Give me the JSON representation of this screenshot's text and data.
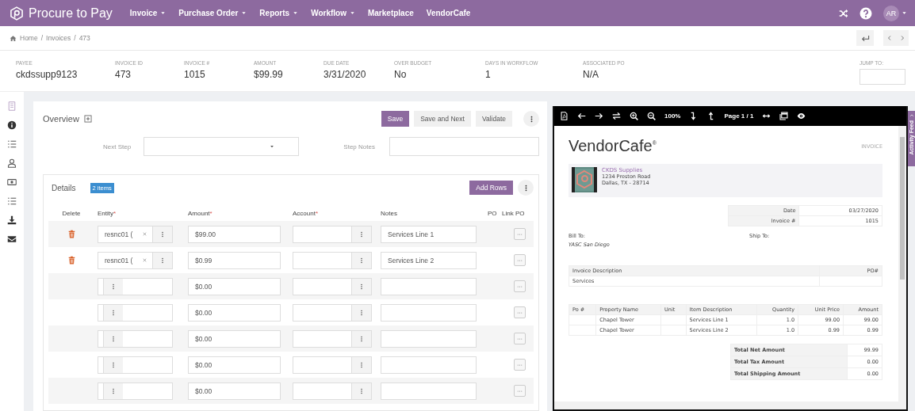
{
  "nav": {
    "brand": "Procure to Pay",
    "menus": [
      {
        "label": "Invoice",
        "dropdown": true
      },
      {
        "label": "Purchase Order",
        "dropdown": true
      },
      {
        "label": "Reports",
        "dropdown": true
      },
      {
        "label": "Workflow",
        "dropdown": true
      },
      {
        "label": "Marketplace",
        "dropdown": false
      },
      {
        "label": "VendorCafe",
        "dropdown": false
      }
    ],
    "avatar": "AR"
  },
  "breadcrumb": {
    "separator": "/",
    "items": [
      "Home",
      "Invoices",
      "473"
    ]
  },
  "summary": {
    "fields": [
      {
        "label": "PAYEE",
        "value": "ckdssupp9123"
      },
      {
        "label": "INVOICE ID",
        "value": "473"
      },
      {
        "label": "INVOICE #",
        "value": "1015"
      },
      {
        "label": "AMOUNT",
        "value": "$99.99"
      },
      {
        "label": "DUE DATE",
        "value": "3/31/2020"
      },
      {
        "label": "OVER BUDGET",
        "value": "No"
      },
      {
        "label": "DAYS IN WORKFLOW",
        "value": "1"
      },
      {
        "label": "ASSOCIATED PO",
        "value": "N/A"
      }
    ],
    "jump_to": {
      "label": "JUMP TO:"
    }
  },
  "overview": {
    "title": "Overview",
    "buttons": [
      {
        "label": "Save",
        "kind": "primary"
      },
      {
        "label": "Save and Next",
        "kind": "default"
      },
      {
        "label": "Validate",
        "kind": "default"
      }
    ],
    "next_step": {
      "label": "Next Step"
    },
    "step_notes": {
      "label": "Step Notes"
    }
  },
  "details": {
    "title": "Details",
    "badge": "2 items",
    "add_rows": "Add Rows",
    "required_mark": "*",
    "columns": [
      {
        "label": "Delete",
        "required": false
      },
      {
        "label": "Entity",
        "required": true
      },
      {
        "label": "Amount",
        "required": true
      },
      {
        "label": "Account",
        "required": true
      },
      {
        "label": "Notes",
        "required": false
      },
      {
        "label": "PO",
        "required": false
      },
      {
        "label": "Link PO",
        "required": false
      }
    ],
    "rows": [
      {
        "deletable": true,
        "entity": "resnc01 (",
        "amount": "$99.00",
        "notes": "Services Line 1"
      },
      {
        "deletable": true,
        "entity": "resnc01 (",
        "amount": "$0.99",
        "notes": "Services Line 2"
      },
      {
        "deletable": false,
        "amount": "$0.00"
      },
      {
        "deletable": false,
        "amount": "$0.00"
      },
      {
        "deletable": false,
        "amount": "$0.00"
      },
      {
        "deletable": false,
        "amount": "$0.00"
      },
      {
        "deletable": false,
        "amount": "$0.00"
      }
    ]
  },
  "viewer": {
    "zoom": "100%",
    "page": "Page 1 / 1",
    "document": {
      "brand": "VendorCafe$^{®}$",
      "doc_type": "INVOICE",
      "vendor": {
        "name": "CKDS Supplies",
        "address": [
          "1234 Preston Road",
          "Dallas, TX - 28714"
        ]
      },
      "meta": [
        {
          "label": "Date",
          "value": "03/27/2020"
        },
        {
          "label": "Invoice #",
          "value": "1015"
        }
      ],
      "bill_to": {
        "label": "Bill To:",
        "value": "YASC San Diego"
      },
      "ship_to": {
        "label": "Ship To:"
      },
      "description": {
        "columns": [
          "Invoice Description",
          "PO#"
        ],
        "rows": [
          {
            "description": "Services"
          }
        ]
      },
      "line_items": {
        "columns": [
          "Po #",
          "Property Name",
          "Unit",
          "Item Description",
          "Quantity",
          "Unit Price",
          "Amount"
        ],
        "rows": [
          {
            "property": "Chapel Tower",
            "item": "Services Line 1",
            "quantity": "1.0",
            "unit_price": "99.00",
            "amount": "99.00"
          },
          {
            "property": "Chapel Tower",
            "item": "Services Line 2",
            "quantity": "1.0",
            "unit_price": "0.99",
            "amount": "0.99"
          }
        ]
      },
      "totals": [
        {
          "label": "Total Net Amount",
          "value": "99.99"
        },
        {
          "label": "Total Tax Amount",
          "value": "0.00"
        },
        {
          "label": "Total Shipping Amount",
          "value": "0.00"
        }
      ]
    }
  },
  "activity_feed": {
    "label": "Activity Feed"
  }
}
